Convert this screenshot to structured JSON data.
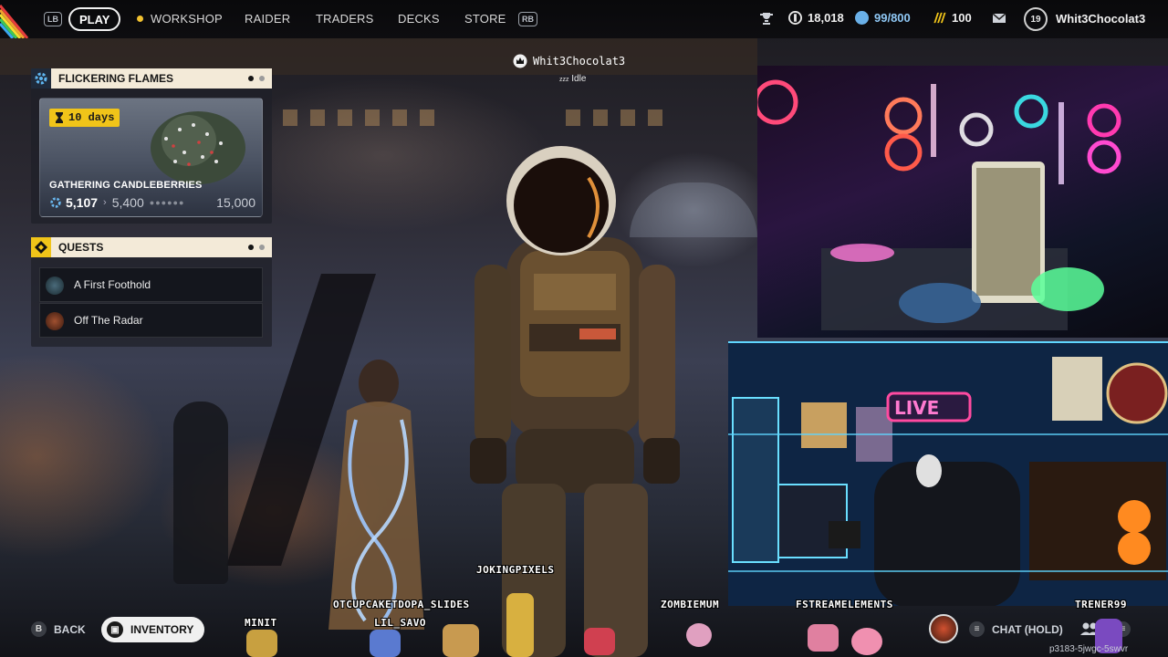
{
  "topbar": {
    "lb": "LB",
    "rb": "RB",
    "play": "PLAY",
    "nav": [
      "WORKSHOP",
      "RAIDER",
      "TRADERS",
      "DECKS",
      "STORE"
    ],
    "currency_1": "18,018",
    "currency_2": "99/800",
    "currency_3": "100",
    "level": "19",
    "username": "Whit3Chocolat3",
    "colors": {
      "accent_yellow": "#f0c419",
      "play_border": "#f0f0f0"
    }
  },
  "player": {
    "name": "Whit3Chocolat3",
    "status": "Idle",
    "status_icon": "zzz"
  },
  "event_panel": {
    "title": "FLICKERING FLAMES",
    "icon": "gear-icon",
    "timer": "10 days",
    "event_name": "GATHERING CANDLEBERRIES",
    "current": "5,107",
    "next": "5,400",
    "goal": "15,000",
    "progress_fraction": 0.34
  },
  "quests_panel": {
    "title": "QUESTS",
    "icon": "diamond-icon",
    "items": [
      {
        "label": "A First Foothold"
      },
      {
        "label": "Off The Radar"
      }
    ]
  },
  "bottom": {
    "back_hint": "B",
    "back_label": "BACK",
    "inventory_label": "INVENTORY",
    "chat_label": "CHAT (HOLD)",
    "room_code": "p3183-5jwgc-5swvr"
  },
  "overlay_names": {
    "n1": "JOKINGPIXELS",
    "n2": "OTCUPCAKETDOPA_SLIDES",
    "n3": "LIL_SAVO",
    "n4": "MINIT",
    "n5": "ZOMBIEMUM",
    "n6": "FSTREAMELEMENTS",
    "n7": "TRENER99"
  }
}
